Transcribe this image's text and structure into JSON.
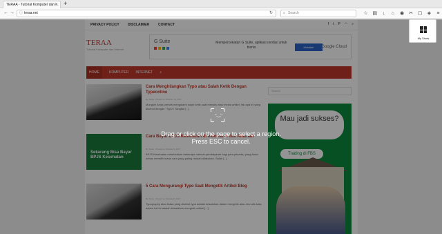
{
  "browser": {
    "tab_title": "TERAA - Tutorial Komputer dan ...",
    "url": "teraa.net",
    "search_placeholder": "Search"
  },
  "site": {
    "brand_name": "TERAA",
    "brand_tagline": "Tutorial Komputer dan Internet",
    "topmenu": [
      "PRIVACY POLICY",
      "DISCLAIMER",
      "CONTACT"
    ],
    "social_icons": [
      "facebook-icon",
      "twitter-icon",
      "pinterest-icon",
      "rss-icon",
      "search-icon"
    ],
    "mainnav": [
      "HOME",
      "KOMPUTER",
      "INTERNET"
    ],
    "ad": {
      "gsuite": "G Suite",
      "text": "Mempercekatan G Suite, aplikasi cerdas untuk bisnis",
      "button": "Mulailah",
      "cloud": "Google Cloud"
    },
    "posts": [
      {
        "title": "Cara Menghilangkan Typo atau Salah Ketik Dengan Typeonline",
        "meta": "By Teraa · Posted on October 10, 2017",
        "excerpt": "Mungkin Anda pernah mengalami salah ketik saat menulis atau media artikel, tak apa ini yang disebut dengan \"Typo\"! Tangkat [...]"
      },
      {
        "title": "Cara Bayar BPJS Kesehatan di Indomaret dan Alfamart",
        "meta": "By Teraa · Posted on October 9, 2017",
        "excerpt": "BPJS Kesehatan memberikan beberapa metode pembayaran bagi para peserta, yang Anda bebas memilih mana cara yang paling mudah dilakukan. Salah [...]"
      },
      {
        "title": "5 Cara Mengurangi Typo Saat Mengetik Artikel Blog",
        "meta": "By Teraa · Posted on October 8, 2017",
        "excerpt": "Typography atau biasa yang disebut typo adalah kesalahan dalam mengetik atau menulis kata, dalam hal ini adalah kesalahan mengetik artikel [...]"
      }
    ],
    "sidebar_search": "Search",
    "side_ad": {
      "headline": "Mau jadi sukses?",
      "button": "Trading di FBS"
    }
  },
  "overlay": {
    "instruction": "Drag or click on the page to select a region. Press ESC to cancel."
  },
  "myshots": {
    "label": "My Shots"
  }
}
